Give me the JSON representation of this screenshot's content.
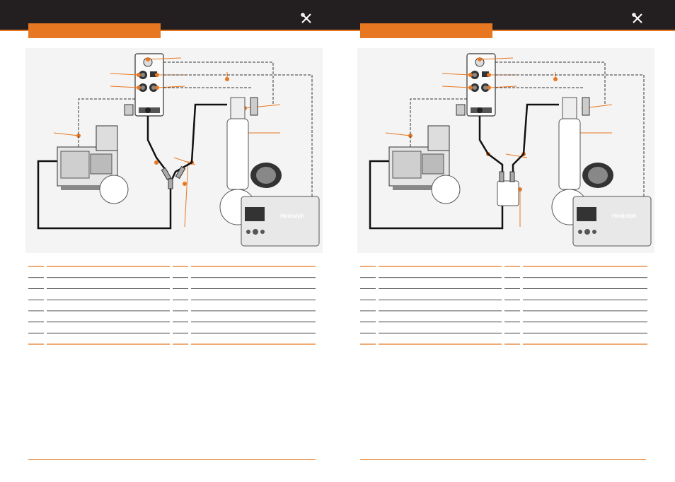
{
  "pages": [
    {
      "side": "left",
      "header_icon": "tools-icon",
      "section_tab_text": "",
      "figure": "setup-diagram-without-bottle",
      "table_rows": 8
    },
    {
      "side": "right",
      "header_icon": "tools-icon",
      "section_tab_text": "",
      "figure": "setup-diagram-with-bottle",
      "table_rows": 8
    }
  ],
  "brand": {
    "accent_color": "#e87722",
    "header_color": "#231f20",
    "logo_text": "Heidolph"
  }
}
